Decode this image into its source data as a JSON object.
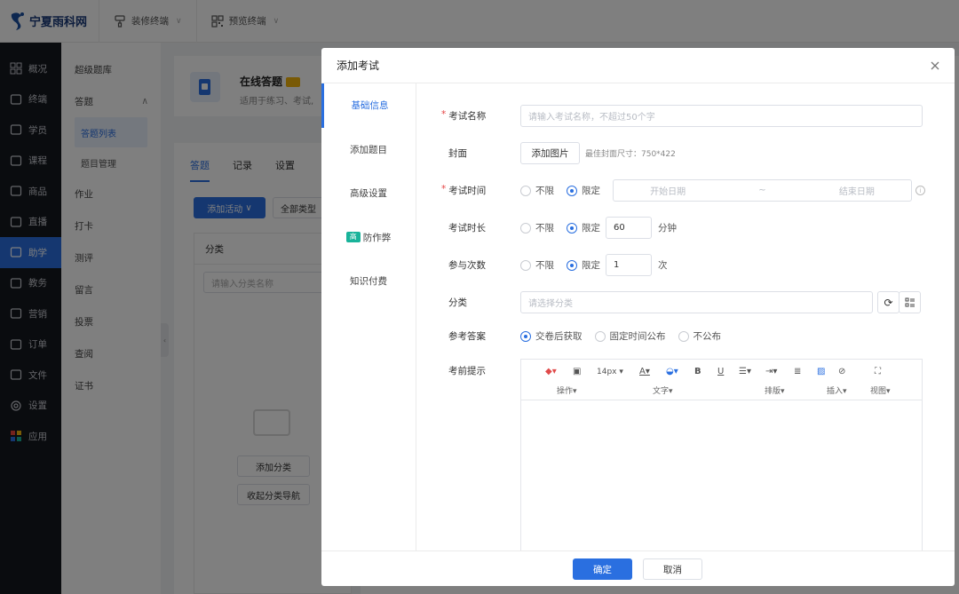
{
  "brand": {
    "name": "宁夏雨科网"
  },
  "topbar": {
    "decorate": "装修终端",
    "preview": "预览终端"
  },
  "sidebar": {
    "items": [
      {
        "label": "概况",
        "icon": "grid-icon"
      },
      {
        "label": "终端",
        "icon": "terminal-icon"
      },
      {
        "label": "学员",
        "icon": "users-icon"
      },
      {
        "label": "课程",
        "icon": "course-icon"
      },
      {
        "label": "商品",
        "icon": "goods-icon"
      },
      {
        "label": "直播",
        "icon": "live-icon"
      },
      {
        "label": "助学",
        "icon": "study-icon"
      },
      {
        "label": "教务",
        "icon": "book-icon"
      },
      {
        "label": "营销",
        "icon": "marketing-icon"
      },
      {
        "label": "订单",
        "icon": "order-icon"
      },
      {
        "label": "文件",
        "icon": "folder-icon"
      },
      {
        "label": "设置",
        "icon": "gear-icon"
      },
      {
        "label": "应用",
        "icon": "apps-icon"
      }
    ]
  },
  "subnav": {
    "items": [
      "超级题库",
      "答题"
    ],
    "sub": [
      "答题列表",
      "题目管理"
    ],
    "items2": [
      "作业",
      "打卡",
      "测评",
      "留言",
      "投票",
      "查阅",
      "证书"
    ]
  },
  "bg": {
    "title": "在线答题",
    "desc": "适用于练习、考试,",
    "tabs": [
      "答题",
      "记录",
      "设置"
    ],
    "add_activity": "添加活动",
    "all_types": "全部类型",
    "category_header": "分类",
    "category_search": "请输入分类名称",
    "add_category": "添加分类",
    "collapse_nav": "收起分类导航"
  },
  "modal": {
    "title": "添加考试",
    "tabs": [
      "基础信息",
      "添加题目",
      "高级设置",
      "防作弊",
      "知识付费"
    ],
    "fields": {
      "name_label": "考试名称",
      "name_placeholder": "请输入考试名称，不超过50个字",
      "cover_label": "封面",
      "cover_button": "添加图片",
      "cover_hint": "最佳封面尺寸：750*422",
      "time_label": "考试时间",
      "unlimited": "不限",
      "limited": "限定",
      "start_date": "开始日期",
      "date_sep": "~",
      "end_date": "结束日期",
      "duration_label": "考试时长",
      "duration_value": "60",
      "duration_unit": "分钟",
      "attempts_label": "参与次数",
      "attempts_value": "1",
      "attempts_unit": "次",
      "category_label": "分类",
      "category_placeholder": "请选择分类",
      "answer_label": "参考答案",
      "answer_opts": [
        "交卷后获取",
        "固定时间公布",
        "不公布"
      ],
      "tip_label": "考前提示"
    },
    "editor": {
      "font_size": "14px",
      "groups": [
        "操作",
        "文字",
        "排版",
        "插入",
        "视图"
      ]
    },
    "ok": "确定",
    "cancel": "取消"
  }
}
